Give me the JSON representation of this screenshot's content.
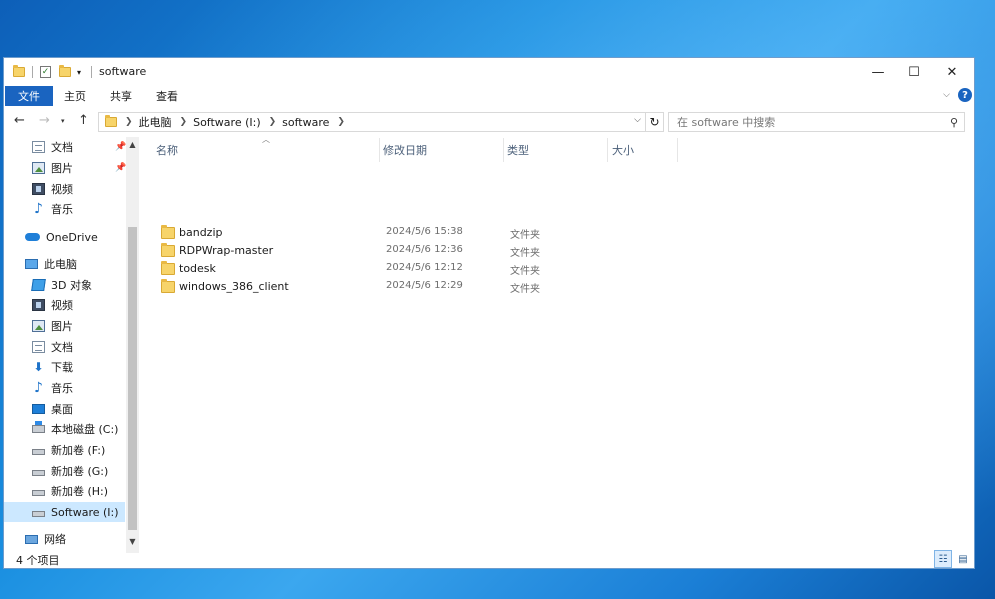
{
  "window": {
    "title": "software",
    "controls": {
      "minimize": "—",
      "maximize": "☐",
      "close": "✕"
    }
  },
  "ribbon": {
    "tabs": [
      "文件",
      "主页",
      "共享",
      "查看"
    ]
  },
  "address": {
    "breadcrumbs": [
      "此电脑",
      "Software (I:)",
      "software"
    ],
    "search_placeholder": "在 software 中搜索"
  },
  "nav": {
    "quick_access": [
      {
        "label": "文档",
        "icon": "documents-icon",
        "pinned": true
      },
      {
        "label": "图片",
        "icon": "pictures-icon",
        "pinned": true
      },
      {
        "label": "视频",
        "icon": "videos-icon",
        "pinned": false
      },
      {
        "label": "音乐",
        "icon": "music-icon",
        "pinned": false
      }
    ],
    "onedrive": "OneDrive",
    "this_pc": "此电脑",
    "pc_items": [
      {
        "label": "3D 对象",
        "icon": "3d-objects-icon"
      },
      {
        "label": "视频",
        "icon": "videos-icon"
      },
      {
        "label": "图片",
        "icon": "pictures-icon"
      },
      {
        "label": "文档",
        "icon": "documents-icon"
      },
      {
        "label": "下载",
        "icon": "downloads-icon"
      },
      {
        "label": "音乐",
        "icon": "music-icon"
      },
      {
        "label": "桌面",
        "icon": "desktop-icon"
      },
      {
        "label": "本地磁盘 (C:)",
        "icon": "system-drive-icon"
      },
      {
        "label": "新加卷 (F:)",
        "icon": "drive-icon"
      },
      {
        "label": "新加卷 (G:)",
        "icon": "drive-icon"
      },
      {
        "label": "新加卷 (H:)",
        "icon": "drive-icon"
      },
      {
        "label": "Software (I:)",
        "icon": "drive-icon",
        "selected": true
      }
    ],
    "network": "网络"
  },
  "columns": [
    "名称",
    "修改日期",
    "类型",
    "大小"
  ],
  "files": [
    {
      "name": "bandzip",
      "date": "2024/5/6 15:38",
      "type": "文件夹"
    },
    {
      "name": "RDPWrap-master",
      "date": "2024/5/6 12:36",
      "type": "文件夹"
    },
    {
      "name": "todesk",
      "date": "2024/5/6 12:12",
      "type": "文件夹"
    },
    {
      "name": "windows_386_client",
      "date": "2024/5/6 12:29",
      "type": "文件夹"
    }
  ],
  "status": {
    "item_count": "4 个项目"
  },
  "colors": {
    "accent": "#1a64c0",
    "selection": "#cce8ff",
    "folder": "#f7d46a"
  }
}
